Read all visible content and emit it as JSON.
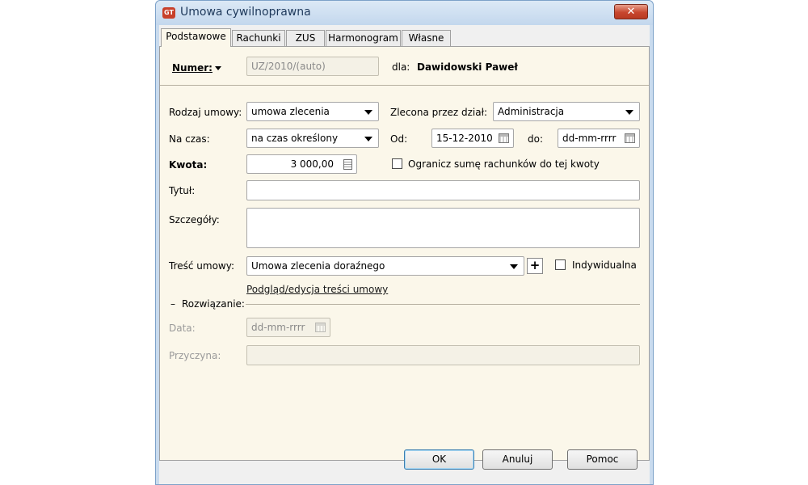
{
  "window": {
    "title": "Umowa cywilnoprawna",
    "icon": "GT",
    "close_label": "✕"
  },
  "tabs": [
    {
      "label": "Podstawowe",
      "active": true
    },
    {
      "label": "Rachunki",
      "active": false
    },
    {
      "label": "ZUS",
      "active": false
    },
    {
      "label": "Harmonogram",
      "active": false
    },
    {
      "label": "Własne",
      "active": false
    }
  ],
  "header": {
    "numer_label": "Numer:",
    "numer_value": "UZ/2010/(auto)",
    "dla_label": "dla:",
    "dla_value": "Dawidowski Paweł"
  },
  "form": {
    "rodzaj_label": "Rodzaj umowy:",
    "rodzaj_value": "umowa zlecenia",
    "zlecona_label": "Zlecona przez dział:",
    "zlecona_value": "Administracja",
    "naczas_label": "Na czas:",
    "naczas_value": "na czas określony",
    "od_label": "Od:",
    "od_value": "15-12-2010",
    "do_label": "do:",
    "do_placeholder": "dd-mm-rrrr",
    "kwota_label": "Kwota:",
    "kwota_value": "3 000,00",
    "ogranicz_label": "Ogranicz sumę rachunków do tej kwoty",
    "ogranicz_checked": false,
    "tytul_label": "Tytuł:",
    "tytul_value": "",
    "szczegoly_label": "Szczegóły:",
    "szczegoly_value": "",
    "tresc_label": "Treść umowy:",
    "tresc_value": "Umowa zlecenia doraźnego",
    "plus_label": "+",
    "indywidualna_label": "Indywidualna",
    "indywidualna_checked": false,
    "podglad_link": "Podgląd/edycja treści umowy"
  },
  "rozwiazanie": {
    "group_label": "Rozwiązanie:",
    "group_toggle": "–",
    "data_label": "Data:",
    "data_placeholder": "dd-mm-rrrr",
    "przyczyna_label": "Przyczyna:",
    "przyczyna_value": ""
  },
  "buttons": {
    "ok": "OK",
    "anuluj": "Anuluj",
    "pomoc": "Pomoc"
  },
  "icons": {
    "app": "app-logo-icon",
    "calendar": "calendar-icon",
    "calculator": "calculator-icon",
    "dropdown": "chevron-down-icon"
  },
  "colors": {
    "title_bar": "#c3d7ed",
    "close_button": "#c7462e",
    "content_bg": "#fbf7ea",
    "window_bg": "#f0f0f0"
  }
}
